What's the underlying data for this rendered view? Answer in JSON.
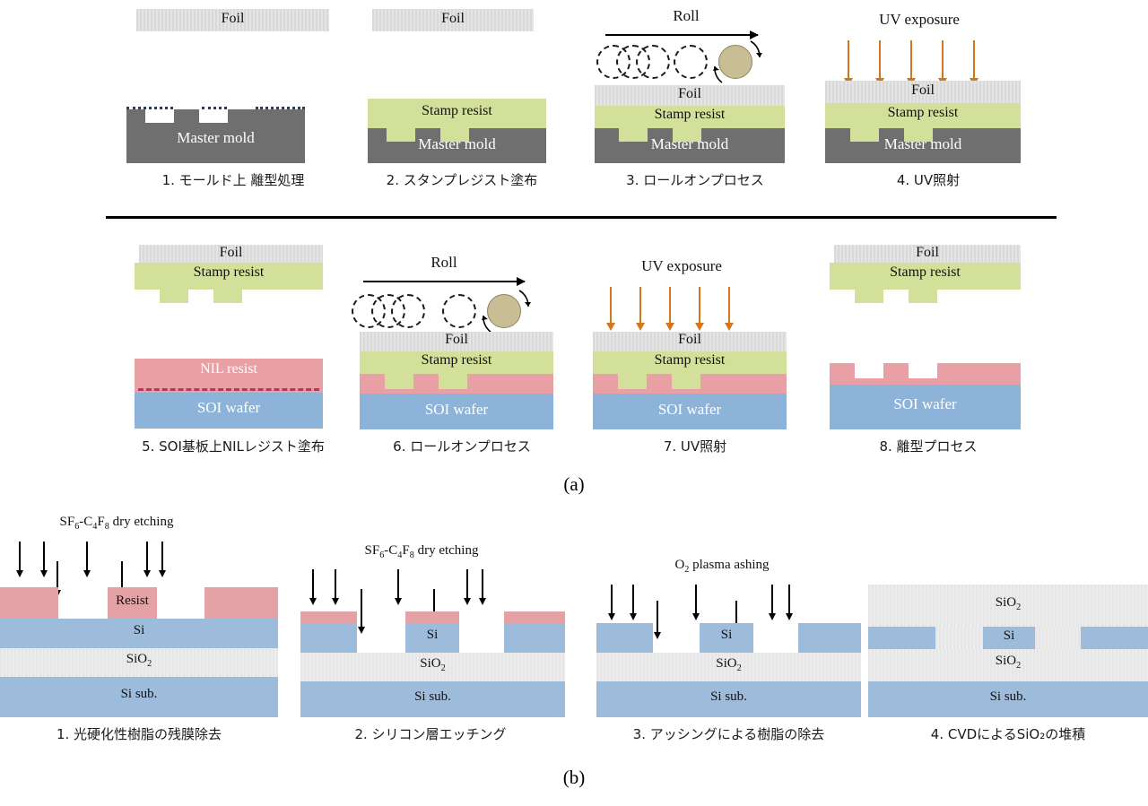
{
  "figure": {
    "subfigure_a_label": "(a)",
    "subfigure_b_label": "(b)"
  },
  "materials": {
    "foil": "Foil",
    "stamp_resist": "Stamp resist",
    "master_mold": "Master mold",
    "nil_resist": "NIL resist",
    "soi_wafer": "SOI wafer",
    "resist": "Resist",
    "si": "Si",
    "sio2": "SiO",
    "sio2_sub": "2",
    "si_sub": "Si sub."
  },
  "annotations": {
    "roll": "Roll",
    "uv_exposure": "UV exposure",
    "dry_etching_pre": "SF",
    "dry_etching_1": "6",
    "dry_etching_mid": "-C",
    "dry_etching_2": "4",
    "dry_etching_f": "F",
    "dry_etching_3": "8",
    "dry_etching_post": " dry etching",
    "ashing_pre": "O",
    "ashing_sub": "2",
    "ashing_post": " plasma ashing"
  },
  "process_a": {
    "steps": [
      {
        "number": "1.",
        "caption": "1. モールド上 離型処理"
      },
      {
        "number": "2.",
        "caption": "2. スタンプレジスト塗布"
      },
      {
        "number": "3.",
        "caption": "3. ロールオンプロセス"
      },
      {
        "number": "4.",
        "caption": "4. UV照射"
      },
      {
        "number": "5.",
        "caption": "5. SOI基板上NILレジスト塗布"
      },
      {
        "number": "6.",
        "caption": "6. ロールオンプロセス"
      },
      {
        "number": "7.",
        "caption": "7. UV照射"
      },
      {
        "number": "8.",
        "caption": "8. 離型プロセス"
      }
    ]
  },
  "process_b": {
    "steps": [
      {
        "number": "1.",
        "caption": "1. 光硬化性樹脂の残膜除去"
      },
      {
        "number": "2.",
        "caption": "2. シリコン層エッチング"
      },
      {
        "number": "3.",
        "caption": "3. アッシングによる樹脂の除去"
      },
      {
        "number": "4.",
        "caption": "4. CVDによるSiO₂の堆積"
      }
    ]
  },
  "colors": {
    "foil": "#dcdcdc",
    "stamp_resist": "#d3e09a",
    "master_mold": "#6f6f6f",
    "nil_resist": "#e8a0a4",
    "soi_wafer": "#8db4d8",
    "si": "#9dbcdc",
    "sio2": "#e8e8e8",
    "resist_pink": "#e4a1a6",
    "uv_arrow": "#d4761a",
    "roller": "#c8bd94"
  }
}
